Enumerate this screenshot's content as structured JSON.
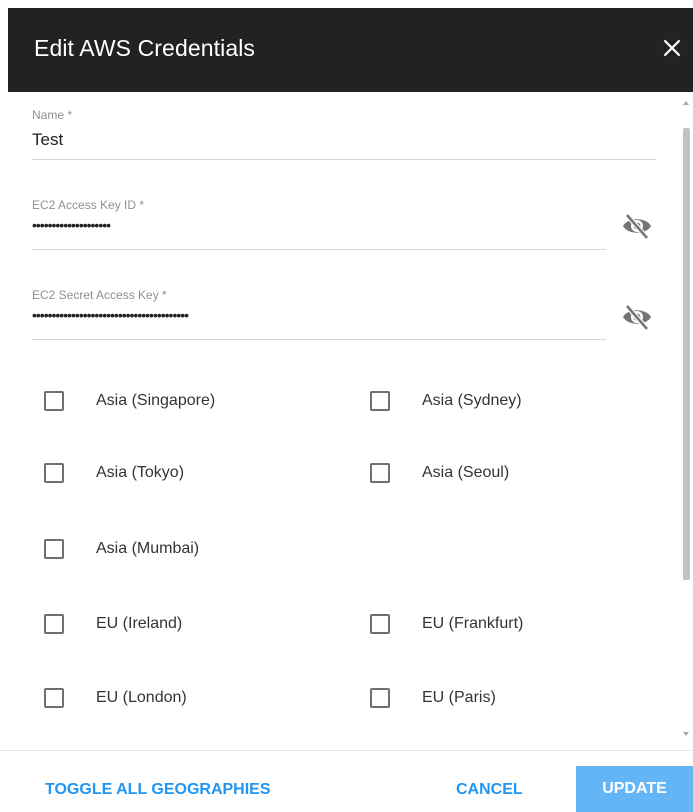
{
  "dialog": {
    "title": "Edit AWS Credentials",
    "close_icon": "close-icon"
  },
  "fields": {
    "name": {
      "label": "Name *",
      "value": "Test"
    },
    "access_key": {
      "label": "EC2 Access Key ID *",
      "value": "••••••••••••••••••••",
      "icon": "eye-off-icon"
    },
    "secret_key": {
      "label": "EC2 Secret Access Key *",
      "value": "••••••••••••••••••••••••••••••••••••••••",
      "icon": "eye-off-icon"
    }
  },
  "regions": [
    {
      "label": "Asia (Singapore)",
      "checked": false
    },
    {
      "label": "Asia (Sydney)",
      "checked": false
    },
    {
      "label": "Asia (Tokyo)",
      "checked": false
    },
    {
      "label": "Asia (Seoul)",
      "checked": false
    },
    {
      "label": "Asia (Mumbai)",
      "checked": false
    },
    {
      "label": "EU (Ireland)",
      "checked": false
    },
    {
      "label": "EU (Frankfurt)",
      "checked": false
    },
    {
      "label": "EU (London)",
      "checked": false
    },
    {
      "label": "EU (Paris)",
      "checked": false
    }
  ],
  "footer": {
    "toggle_label": "TOGGLE ALL GEOGRAPHIES",
    "cancel_label": "CANCEL",
    "update_label": "UPDATE"
  },
  "colors": {
    "header_bg": "#222222",
    "accent": "#2196f3",
    "update_bg": "#64b5f6"
  }
}
